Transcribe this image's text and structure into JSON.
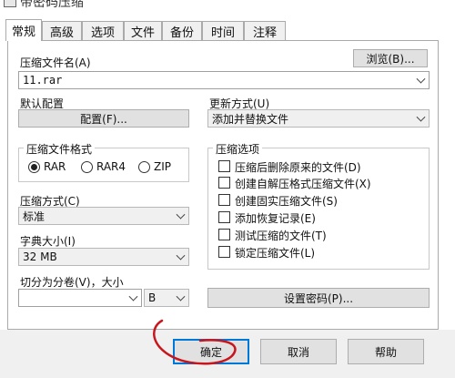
{
  "window": {
    "title": "带密码压缩"
  },
  "tabs": [
    {
      "label": "常规"
    },
    {
      "label": "高级"
    },
    {
      "label": "选项"
    },
    {
      "label": "文件"
    },
    {
      "label": "备份"
    },
    {
      "label": "时间"
    },
    {
      "label": "注释"
    }
  ],
  "archive": {
    "label": "压缩文件名(A)",
    "value": "11.rar",
    "browse_button": "浏览(B)..."
  },
  "profile": {
    "label": "默认配置",
    "button": "配置(F)..."
  },
  "update": {
    "label": "更新方式(U)",
    "value": "添加并替换文件"
  },
  "format": {
    "title": "压缩文件格式",
    "options": [
      {
        "label": "RAR",
        "selected": true
      },
      {
        "label": "RAR4",
        "selected": false
      },
      {
        "label": "ZIP",
        "selected": false
      }
    ]
  },
  "compression_method": {
    "label": "压缩方式(C)",
    "value": "标准"
  },
  "dictionary": {
    "label": "字典大小(I)",
    "value": "32 MB"
  },
  "split": {
    "label": "切分为分卷(V)，大小",
    "value": "",
    "unit": "B"
  },
  "options": {
    "title": "压缩选项",
    "items": [
      {
        "label": "压缩后删除原来的文件(D)",
        "checked": false
      },
      {
        "label": "创建自解压格式压缩文件(X)",
        "checked": false
      },
      {
        "label": "创建固实压缩文件(S)",
        "checked": false
      },
      {
        "label": "添加恢复记录(E)",
        "checked": false
      },
      {
        "label": "测试压缩的文件(T)",
        "checked": false
      },
      {
        "label": "锁定压缩文件(L)",
        "checked": false
      }
    ]
  },
  "password_button": "设置密码(P)...",
  "footer": {
    "ok": "确定",
    "cancel": "取消",
    "help": "帮助"
  },
  "annotation": {
    "color": "#c8161d"
  }
}
